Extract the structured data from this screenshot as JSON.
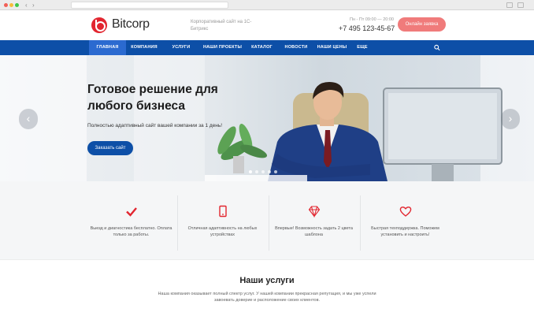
{
  "header": {
    "logo": "Bitcorp",
    "tagline": "Корпоративный сайт на 1С-Битрикс",
    "hours": "Пн - Пт 09:00 — 20:00",
    "phone": "+7 495 123-45-67",
    "cta": "Онлайн заявка"
  },
  "nav": {
    "items": [
      "ГЛАВНАЯ",
      "КОМПАНИЯ",
      "УСЛУГИ",
      "НАШИ ПРОЕКТЫ",
      "КАТАЛОГ",
      "НОВОСТИ",
      "НАШИ ЦЕНЫ",
      "ЕЩЕ"
    ],
    "active_index": 0
  },
  "hero": {
    "title": "Готовое решение для любого бизнеса",
    "subtitle": "Полностью адаптивный сайт вашей компании за 1 день!",
    "button": "Заказать сайт",
    "prev_glyph": "‹",
    "next_glyph": "›",
    "slide_count": 5,
    "active_slide": 0
  },
  "features": [
    {
      "icon": "check-icon",
      "text": "Выезд и диагностика бесплатно. Оплата только за работы."
    },
    {
      "icon": "mobile-icon",
      "text": "Отличная адаптивность на любых устройствах"
    },
    {
      "icon": "diamond-icon",
      "text": "Впервые! Возможность задать 2 цвета шаблона"
    },
    {
      "icon": "heart-icon",
      "text": "Быстрая техподдержка. Поможем установить и настроить!"
    }
  ],
  "services": {
    "title": "Наши услуги",
    "text": "Наша компания оказывает полный спектр услуг. У нашей компании прекрасная репутация, и мы уже успели завоевать доверие и расположение своих клиентов."
  },
  "colors": {
    "brand_red": "#e2252f",
    "nav_blue": "#0d4fa7",
    "nav_active": "#2b6ad0",
    "cta_pink": "#f07b7b"
  }
}
